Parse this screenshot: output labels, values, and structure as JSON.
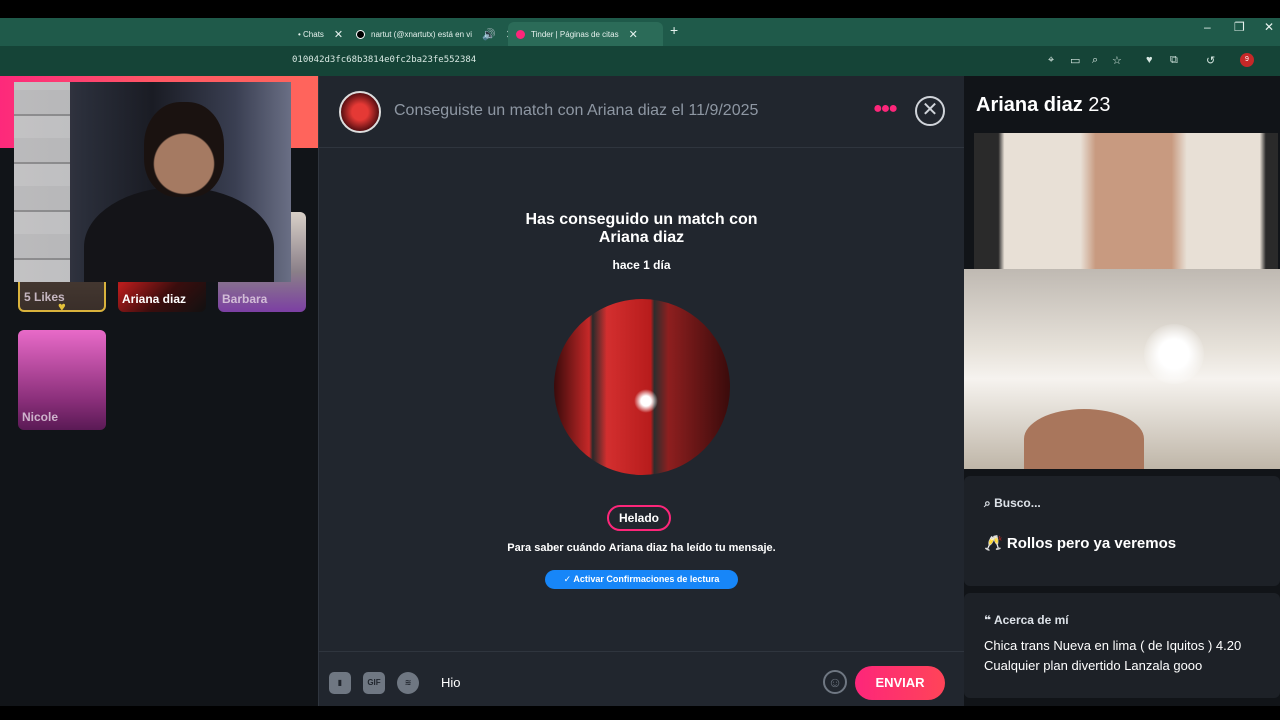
{
  "browser": {
    "tabs": [
      {
        "label": "• Chats"
      },
      {
        "label": "nartut (@xnartutx) está en vi"
      },
      {
        "label": "Tinder | Páginas de citas"
      }
    ],
    "new_tab": "+",
    "url": "010042d3fc68b3814e0fc2ba23fe552384",
    "profile_badge": "9",
    "window_controls": {
      "minimize": "–",
      "restore": "❐",
      "close": "✕"
    }
  },
  "sidebar": {
    "likes_count": "5",
    "likes_label": "5 Likes",
    "matches": [
      {
        "name": "Ariana diaz"
      },
      {
        "name": "Barbara"
      },
      {
        "name": "Nicole"
      }
    ]
  },
  "chat": {
    "header_title": "Conseguiste un match con Ariana diaz el 11/9/2025",
    "match_text_prefix": "Has conseguido un match con",
    "match_name": "Ariana diaz",
    "match_time": "hace 1 día",
    "chip": "Helado",
    "read_info_prefix": "Para saber cuándo",
    "read_info_name": "Ariana diaz",
    "read_info_suffix": "ha leído tu mensaje.",
    "read_button": "✓ Activar Confirmaciones de lectura",
    "composer": {
      "gif_label": "GIF",
      "message_value": "Hio",
      "send_label": "ENVIAR"
    }
  },
  "profile": {
    "name": "Ariana diaz",
    "age": "23",
    "busco_label": "Busco...",
    "busco_emoji": "🥂",
    "busco_value": "Rollos pero ya veremos",
    "acerca_label": "Acerca de mí",
    "acerca_text": "Chica trans Nueva en lima ( de Iquitos ) 4.20 Cualquier plan divertido Lanzala gooo"
  },
  "colors": {
    "brand_gradient_start": "#fd267a",
    "brand_gradient_end": "#ff4458",
    "read_button": "#1786f8"
  }
}
